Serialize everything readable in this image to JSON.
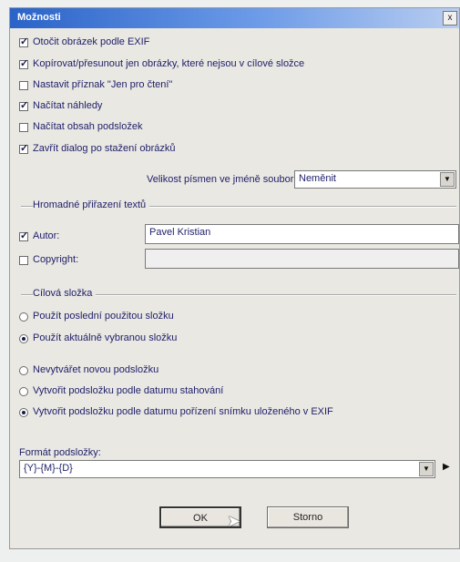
{
  "window": {
    "title": "Možnosti",
    "close_label": "x"
  },
  "options": [
    {
      "label": "Otočit obrázek podle EXIF",
      "checked": true
    },
    {
      "label": "Kopírovat/přesunout jen obrázky, které nejsou v cílové složce",
      "checked": true
    },
    {
      "label": "Nastavit příznak \"Jen pro čtení\"",
      "checked": false
    },
    {
      "label": "Načítat náhledy",
      "checked": true
    },
    {
      "label": "Načítat obsah podsložek",
      "checked": false
    },
    {
      "label": "Zavřít dialog po stažení obrázků",
      "checked": true
    }
  ],
  "font_size": {
    "label": "Velikost písmen ve jméně souboru:",
    "value": "Neměnit"
  },
  "bulk_text": {
    "legend": "Hromadné přiřazení textů",
    "author": {
      "label": "Autor:",
      "checked": true,
      "value": "Pavel Kristian"
    },
    "copyright": {
      "label": "Copyright:",
      "checked": false,
      "value": ""
    }
  },
  "target_folder": {
    "legend": "Cílová složka",
    "options": [
      {
        "label": "Použít poslední použitou složku",
        "selected": false
      },
      {
        "label": "Použít aktuálně vybranou složku",
        "selected": true
      }
    ]
  },
  "subfolder": {
    "options": [
      {
        "label": "Nevytvářet novou podsložku",
        "selected": false
      },
      {
        "label": "Vytvořit podsložku podle datumu stahování",
        "selected": false
      },
      {
        "label": "Vytvořit podsložku podle datumu pořízení snímku uloženého v EXIF",
        "selected": true
      }
    ]
  },
  "subfolder_format": {
    "label": "Formát podsložky:",
    "value": "{Y}-{M}-{D}"
  },
  "buttons": {
    "ok": "OK",
    "cancel": "Storno"
  }
}
